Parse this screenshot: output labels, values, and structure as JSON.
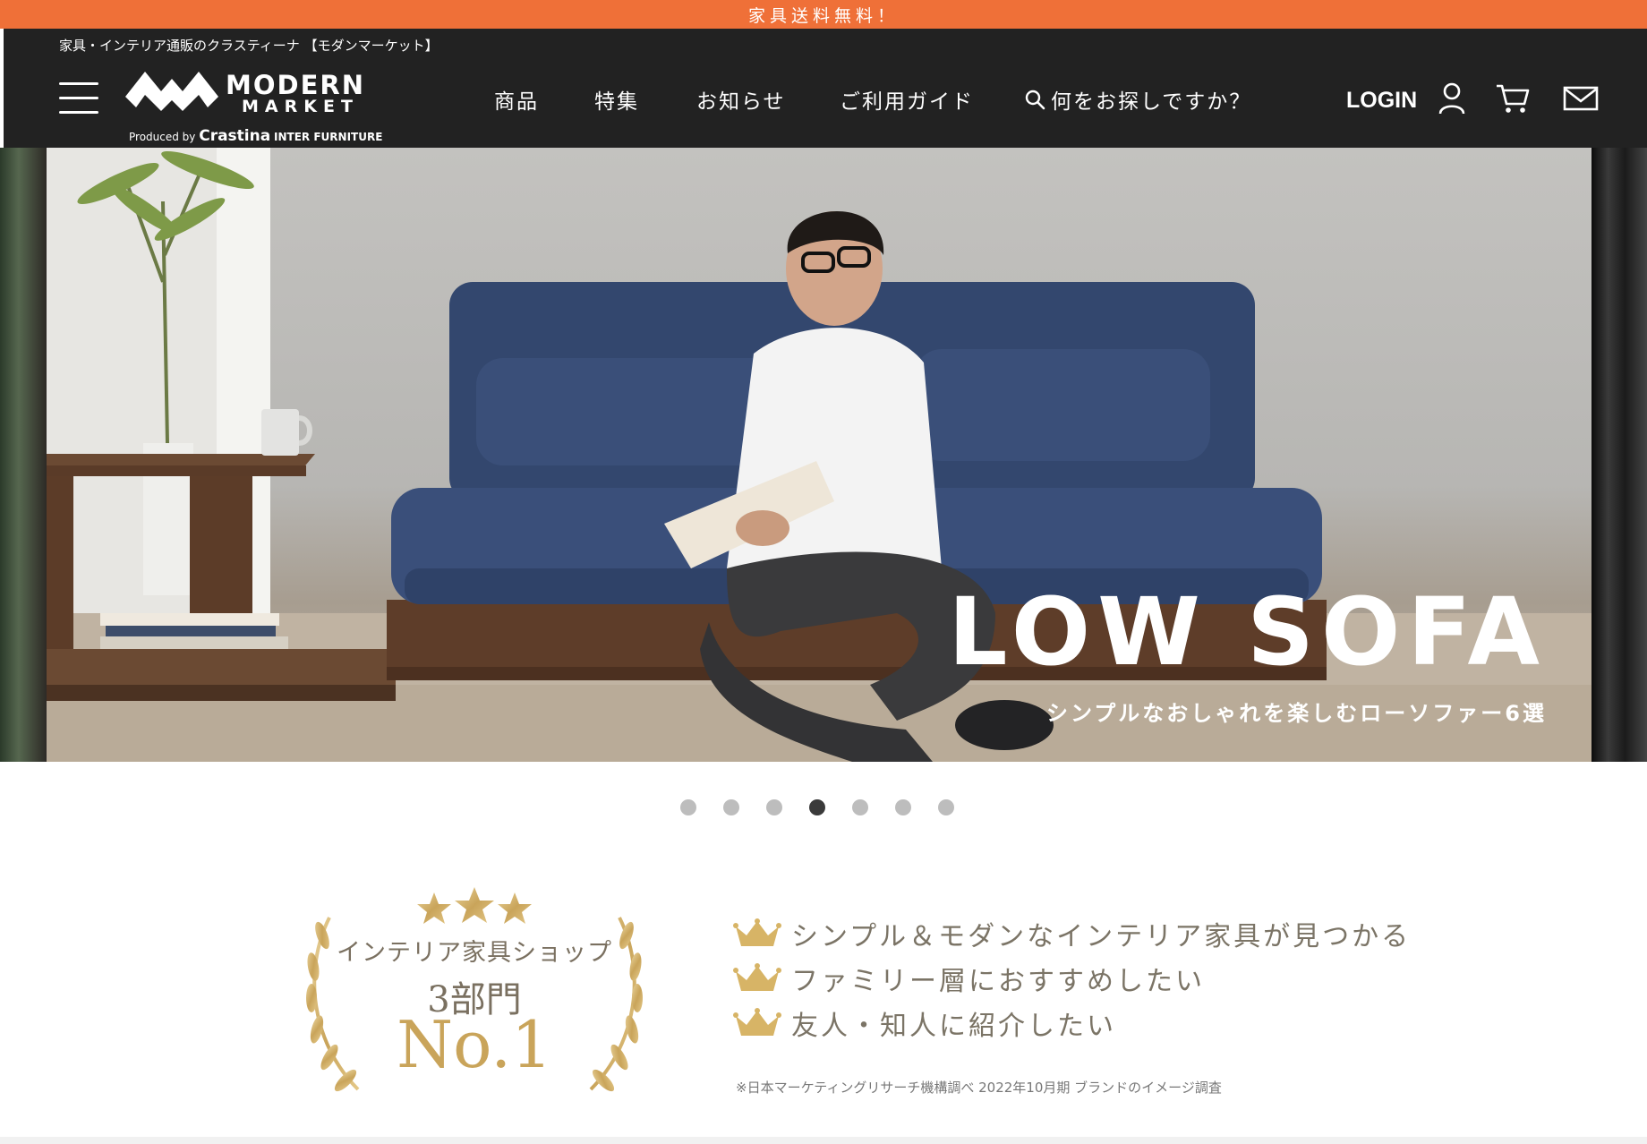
{
  "promo": {
    "text": "家具送料無料！"
  },
  "header": {
    "tagline": "家具・インテリア通販のクラスティーナ 【モダンマーケット】",
    "logo": {
      "line1": "MODERN",
      "line2": "MARKET",
      "produced_by": "Produced by",
      "brand": "Crastina",
      "suffix": "INTER FURNITURE"
    },
    "nav": [
      "商品",
      "特集",
      "お知らせ",
      "ご利用ガイド"
    ],
    "search_placeholder": "何をお探しですか？",
    "login_label": "LOGIN",
    "icons": [
      "menu-icon",
      "search-icon",
      "user-icon",
      "cart-icon",
      "mail-icon"
    ]
  },
  "hero": {
    "title": "LOW SOFA",
    "subtitle": "シンプルなおしゃれを楽しむローソファー6選"
  },
  "carousel": {
    "count": 7,
    "active_index": 3
  },
  "award": {
    "line1": "インテリア家具ショップ",
    "line2": "3部門",
    "line3": "No.1",
    "features": [
      "シンプル＆モダンなインテリア家具が見つかる",
      "ファミリー層におすすめしたい",
      "友人・知人に紹介したい"
    ],
    "note": "※日本マーケティングリサーチ機構調べ 2022年10月期 ブランドのイメージ調査"
  },
  "colors": {
    "promo": "#ef7038",
    "header": "#222222",
    "gold": "#c9a45a",
    "sofa": "#33476e"
  }
}
